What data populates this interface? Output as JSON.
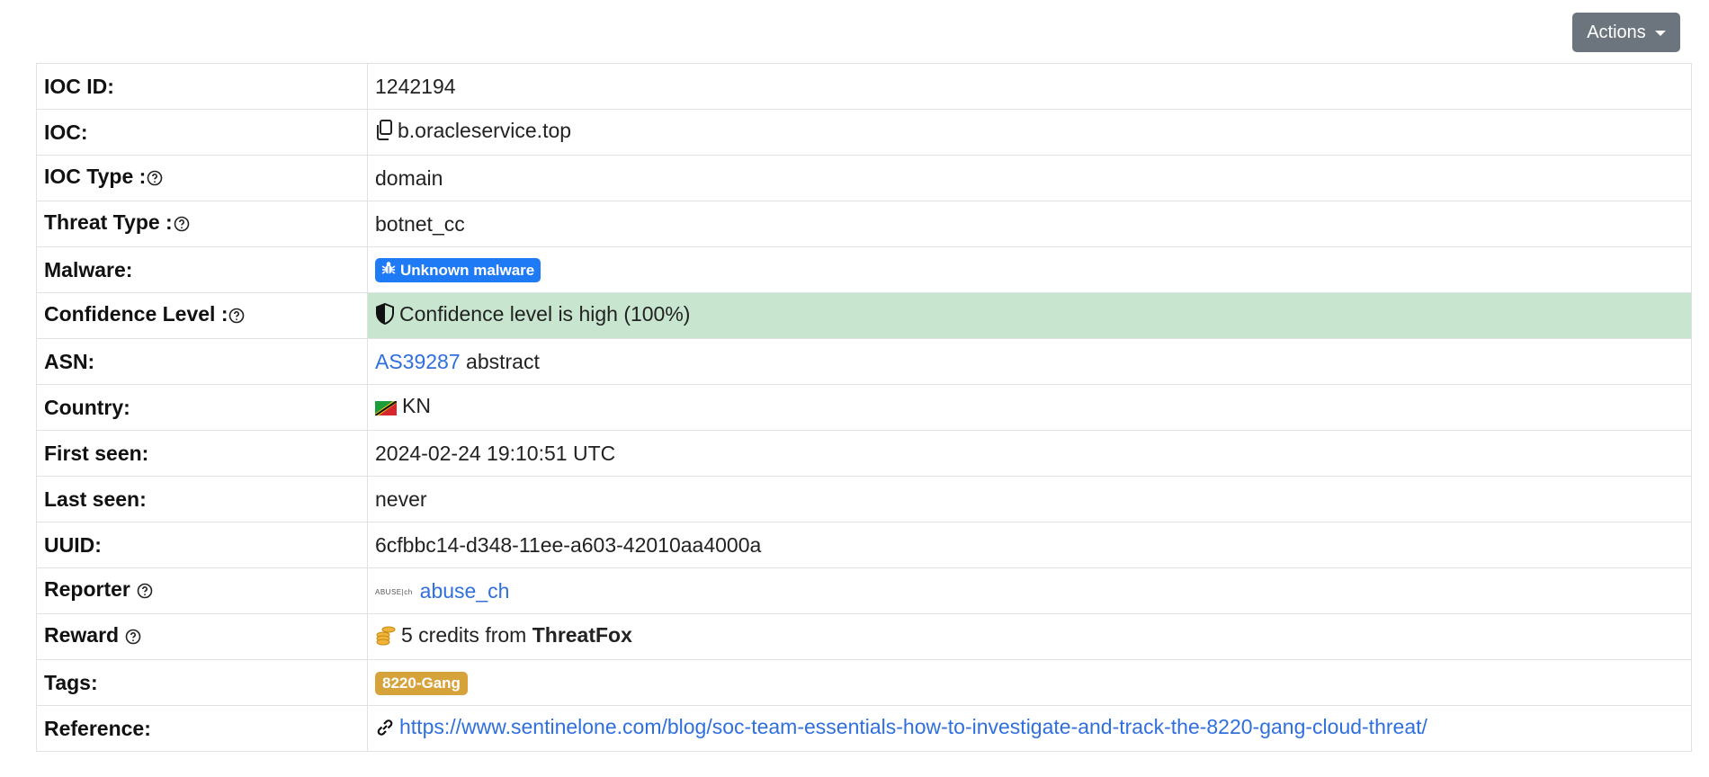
{
  "toolbar": {
    "actions_label": "Actions"
  },
  "rows": {
    "ioc_id": {
      "label": "IOC ID:",
      "value": "1242194"
    },
    "ioc": {
      "label": "IOC:",
      "value": "b.oracleservice.top"
    },
    "ioc_type": {
      "label": "IOC Type :",
      "value": "domain"
    },
    "threat_type": {
      "label": "Threat Type :",
      "value": "botnet_cc"
    },
    "malware": {
      "label": "Malware:",
      "badge": "Unknown malware"
    },
    "confidence": {
      "label": "Confidence Level :",
      "value": "Confidence level is high (100%)"
    },
    "asn": {
      "label": "ASN:",
      "asn_link": "AS39287",
      "asn_name": "abstract"
    },
    "country": {
      "label": "Country:",
      "value": "KN"
    },
    "first_seen": {
      "label": "First seen:",
      "value": "2024-02-24 19:10:51 UTC"
    },
    "last_seen": {
      "label": "Last seen:",
      "value": "never"
    },
    "uuid": {
      "label": "UUID:",
      "value": "6cfbbc14-d348-11ee-a603-42010aa4000a"
    },
    "reporter": {
      "label": "Reporter",
      "logo_text": "ABUSE|ch",
      "value": "abuse_ch"
    },
    "reward": {
      "label": "Reward",
      "value_prefix": "5 credits from",
      "value_strong": "ThreatFox"
    },
    "tags": {
      "label": "Tags:",
      "tag": "8220-Gang"
    },
    "reference": {
      "label": "Reference:",
      "value": "https://www.sentinelone.com/blog/soc-team-essentials-how-to-investigate-and-track-the-8220-gang-cloud-threat/"
    }
  },
  "colors": {
    "highlight_row": "#c8e6cf",
    "link": "#2f6fde",
    "badge_blue": "#1f7af5",
    "badge_gold": "#d6a23a",
    "button": "#6c757d"
  },
  "icons": [
    "copy-icon",
    "help-icon",
    "bug-icon",
    "shield-icon",
    "flag-icon",
    "coins-icon",
    "link-icon",
    "caret-down-icon"
  ]
}
